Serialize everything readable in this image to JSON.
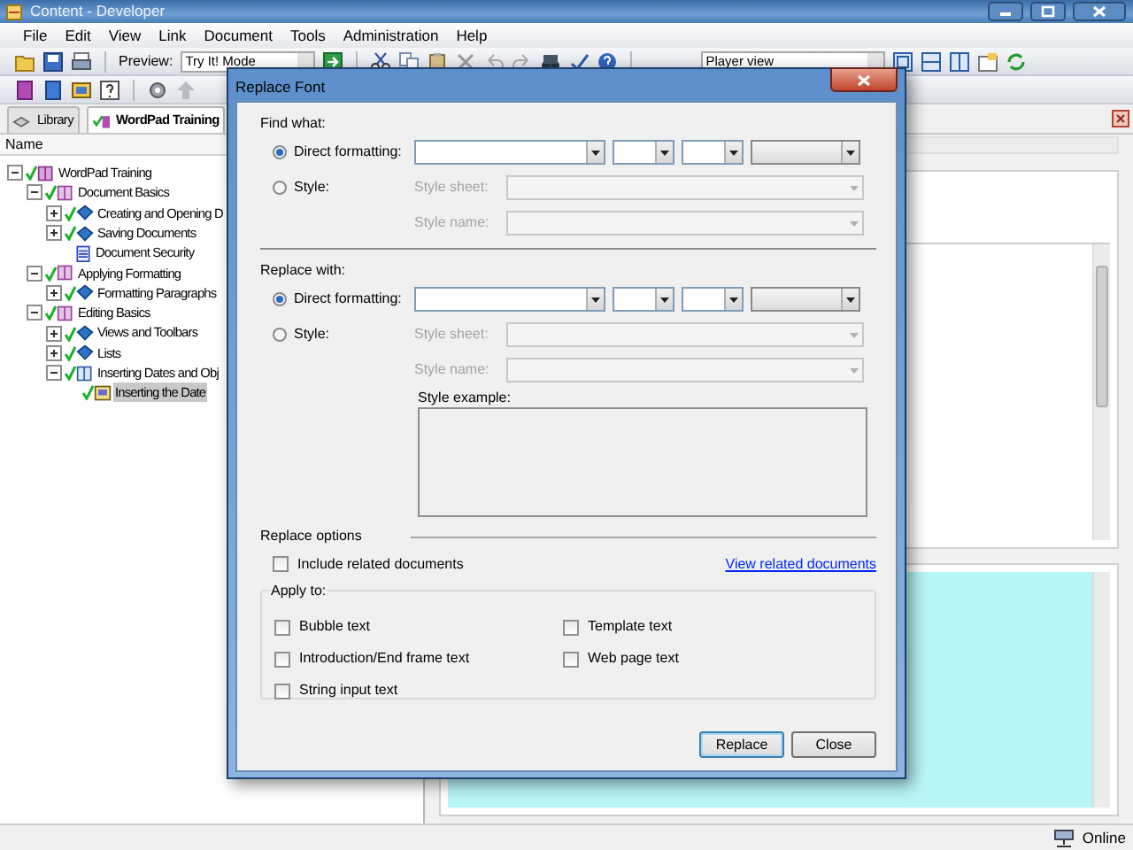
{
  "window": {
    "title": "Content - Developer"
  },
  "menu": [
    "File",
    "Edit",
    "View",
    "Link",
    "Document",
    "Tools",
    "Administration",
    "Help"
  ],
  "toolbar": {
    "preview_label": "Preview:",
    "preview_mode": "Try It! Mode",
    "view_mode": "Player view"
  },
  "tabs": [
    {
      "label": "Library",
      "selected": false
    },
    {
      "label": "WordPad Training",
      "selected": true
    }
  ],
  "tree": {
    "column": "Name",
    "items": [
      {
        "label": "WordPad Training",
        "kind": "module",
        "checked": true,
        "expanded": true,
        "selected": false,
        "children": [
          {
            "label": "Document Basics",
            "kind": "section",
            "checked": true,
            "expanded": true,
            "selected": false,
            "children": [
              {
                "label": "Creating and Opening D",
                "kind": "topic",
                "checked": true,
                "expanded": false,
                "selected": false
              },
              {
                "label": "Saving Documents",
                "kind": "topic",
                "checked": true,
                "expanded": false,
                "selected": false
              },
              {
                "label": "Document Security",
                "kind": "document",
                "checked": false,
                "selected": false
              }
            ]
          },
          {
            "label": "Applying Formatting",
            "kind": "section",
            "checked": true,
            "expanded": true,
            "selected": false,
            "children": [
              {
                "label": "Formatting Paragraphs",
                "kind": "topic",
                "checked": true,
                "expanded": false,
                "selected": false
              }
            ]
          },
          {
            "label": "Editing Basics",
            "kind": "section",
            "checked": true,
            "expanded": true,
            "selected": false,
            "children": [
              {
                "label": "Views and Toolbars",
                "kind": "topic",
                "checked": true,
                "expanded": false,
                "selected": false
              },
              {
                "label": "Lists",
                "kind": "topic",
                "checked": true,
                "expanded": false,
                "selected": false
              },
              {
                "label": "Inserting Dates and Obj",
                "kind": "section-open",
                "checked": true,
                "expanded": true,
                "selected": false,
                "children": [
                  {
                    "label": "Inserting the Date",
                    "kind": "frame",
                    "checked": true,
                    "selected": true
                  }
                ]
              }
            ]
          }
        ]
      }
    ]
  },
  "dialog": {
    "title": "Replace Font",
    "find": {
      "heading": "Find what:",
      "direct": {
        "label": "Direct formatting:",
        "selected": true
      },
      "style": {
        "label": "Style:",
        "selected": false
      },
      "fields": [
        {
          "label": "Style sheet:",
          "disabled": true
        },
        {
          "label": "Style name:",
          "disabled": true
        }
      ]
    },
    "replace": {
      "heading": "Replace with:",
      "direct": {
        "label": "Direct formatting:",
        "selected": true
      },
      "style": {
        "label": "Style:",
        "selected": false
      },
      "fields": [
        {
          "label": "Style sheet:",
          "disabled": true
        },
        {
          "label": "Style name:",
          "disabled": true
        }
      ],
      "example_label": "Style example:"
    },
    "options": {
      "heading": "Replace options",
      "include": {
        "label": "Include related documents",
        "checked": false
      },
      "link": "View related documents"
    },
    "apply_to": {
      "legend": "Apply to:",
      "items": [
        {
          "label": "Bubble text",
          "checked": false
        },
        {
          "label": "Template text",
          "checked": false
        },
        {
          "label": "Introduction/End frame text",
          "checked": false
        },
        {
          "label": "Web page text",
          "checked": false
        },
        {
          "label": "String input text",
          "checked": false
        }
      ]
    },
    "buttons": [
      {
        "label": "Replace",
        "default": true
      },
      {
        "label": "Close",
        "default": false
      }
    ]
  },
  "status_bar": {
    "state": "Online"
  }
}
